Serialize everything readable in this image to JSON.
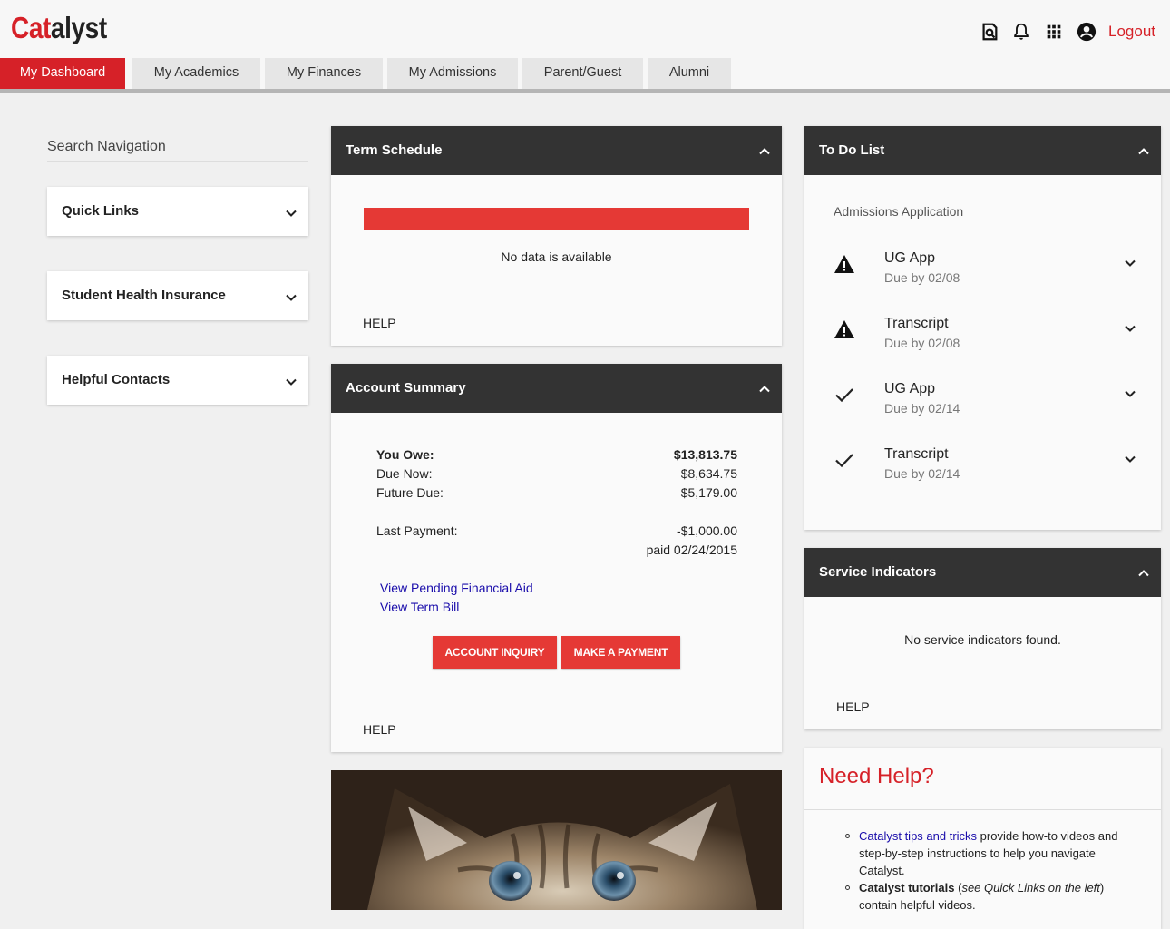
{
  "header": {
    "logo_part1": "Cat",
    "logo_part2": "alyst",
    "logout_label": "Logout",
    "icons": [
      "search-doc-icon",
      "bell-icon",
      "apps-grid-icon",
      "account-circle-icon"
    ]
  },
  "tabs": [
    {
      "label": "My Dashboard",
      "active": true
    },
    {
      "label": "My Academics",
      "active": false
    },
    {
      "label": "My Finances",
      "active": false
    },
    {
      "label": "My Admissions",
      "active": false
    },
    {
      "label": "Parent/Guest",
      "active": false
    },
    {
      "label": "Alumni",
      "active": false
    }
  ],
  "sidebar": {
    "search_label": "Search Navigation",
    "items": [
      {
        "label": "Quick Links"
      },
      {
        "label": "Student Health Insurance"
      },
      {
        "label": "Helpful Contacts"
      }
    ]
  },
  "term_schedule": {
    "title": "Term Schedule",
    "message": "No data is available",
    "help": "HELP"
  },
  "account_summary": {
    "title": "Account Summary",
    "you_owe_label": "You Owe:",
    "you_owe_value": "$13,813.75",
    "due_now_label": "Due Now:",
    "due_now_value": "$8,634.75",
    "future_due_label": "Future Due:",
    "future_due_value": "$5,179.00",
    "last_payment_label": "Last Payment:",
    "last_payment_value": "-$1,000.00",
    "last_payment_date": "paid 02/24/2015",
    "link_financial_aid": "View Pending Financial Aid",
    "link_term_bill": "View Term Bill",
    "btn_inquiry": "ACCOUNT INQUIRY",
    "btn_payment": "MAKE A PAYMENT",
    "help": "HELP"
  },
  "todo": {
    "title": "To Do List",
    "section": "Admissions Application",
    "items": [
      {
        "title": "UG App",
        "due": "Due by 02/08",
        "status": "warning-icon"
      },
      {
        "title": "Transcript",
        "due": "Due by 02/08",
        "status": "warning-icon"
      },
      {
        "title": "UG App",
        "due": "Due by 02/14",
        "status": "check-icon"
      },
      {
        "title": "Transcript",
        "due": "Due by 02/14",
        "status": "check-icon"
      }
    ]
  },
  "service_indicators": {
    "title": "Service Indicators",
    "message": "No service indicators found.",
    "help": "HELP"
  },
  "need_help": {
    "title": "Need Help?",
    "item1_link": "Catalyst tips and tricks",
    "item1_text": " provide how-to videos and step-by-step instructions to help you navigate Catalyst.",
    "item2_bold": "Catalyst tutorials",
    "item2_open": " (",
    "item2_italic": "see Quick Links on the left",
    "item2_close": ")",
    "item2_text": " contain helpful videos."
  },
  "colors": {
    "brand_red": "#d62128",
    "button_red": "#e53935",
    "card_header": "#333333",
    "link_blue": "#1a0dab"
  }
}
